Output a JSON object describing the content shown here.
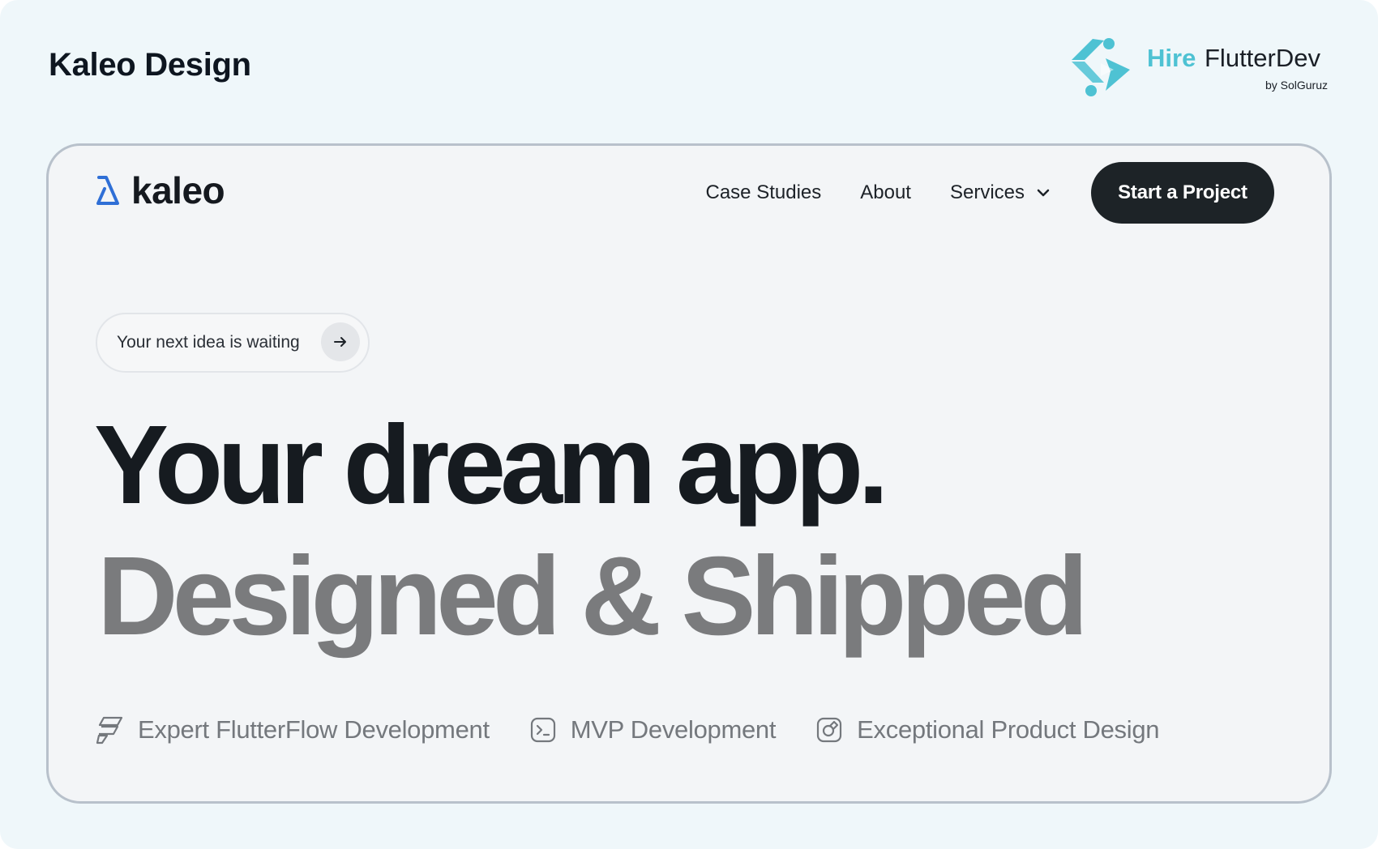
{
  "page": {
    "title": "Kaleo Design"
  },
  "brand_badge": {
    "hire": "Hire",
    "flutterdev": "FlutterDev",
    "byline": "by SolGuruz",
    "accent_color": "#4ec2d3",
    "icon": "hire-flutterdev-logo-icon"
  },
  "site": {
    "logo": {
      "icon": "kaleo-logo-icon",
      "word": "kaleo",
      "accent_color": "#2f6fd6"
    },
    "nav": {
      "items": [
        {
          "label": "Case Studies"
        },
        {
          "label": "About"
        },
        {
          "label": "Services",
          "icon": "chevron-down-icon"
        }
      ],
      "cta": "Start a Project"
    },
    "hero": {
      "pill_text": "Your next idea is waiting",
      "pill_icon": "arrow-right-icon",
      "headline_line1": "Your dream app.",
      "headline_line2": "Designed & Shipped",
      "features": [
        {
          "icon": "flutterflow-icon",
          "label": "Expert FlutterFlow Development"
        },
        {
          "icon": "terminal-icon",
          "label": "MVP Development"
        },
        {
          "icon": "design-icon",
          "label": "Exceptional Product Design"
        }
      ]
    },
    "colors": {
      "cta_bg": "#1d2327",
      "headline_primary": "#161b20",
      "headline_secondary": "#7a7b7d"
    }
  }
}
